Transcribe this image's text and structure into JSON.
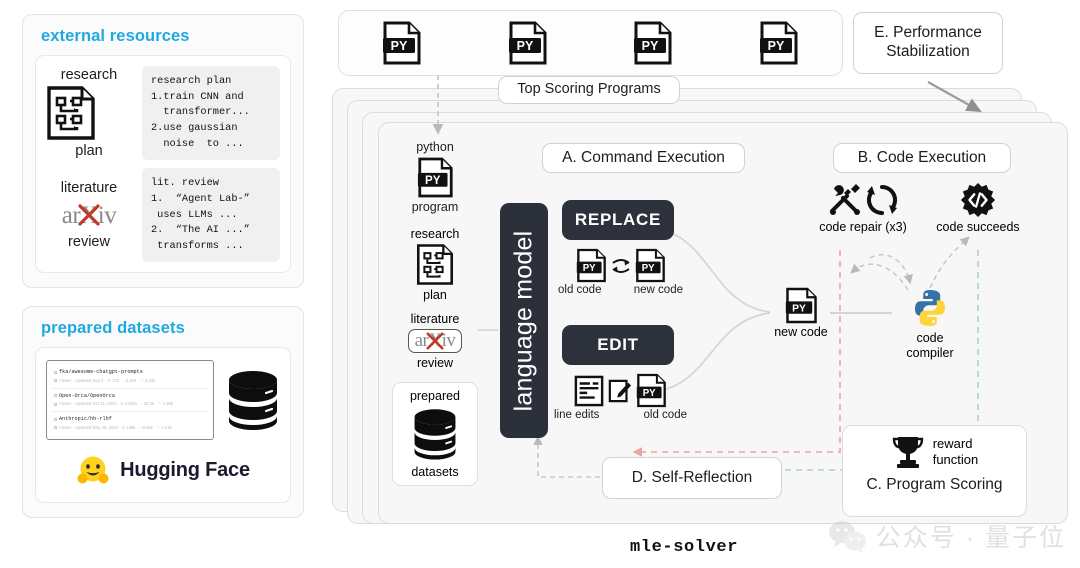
{
  "diagram": {
    "footer_label": "mle-solver",
    "watermark_text": "公众号 · 量子位",
    "accent_blue": "#22a8e0",
    "dark_block": "#2b303b",
    "arrow_red": "#e8a5a5",
    "arrow_green": "#a9d7b4",
    "arrow_gray": "#c9c9c9"
  },
  "external_resources": {
    "title": "external resources",
    "items": [
      {
        "label_top": "research",
        "label_bottom": "plan",
        "icon": "research-plan-document-icon",
        "code_text": "research plan\n1.train CNN and\n  transformer...\n2.use gaussian\n  noise  to ..."
      },
      {
        "label_top": "literature",
        "label_bottom": "review",
        "icon": "arxiv-logo-icon",
        "logo_text": "arXiv",
        "code_text": "lit. review\n1.  “Agent Lab-”\n uses LLMs ...\n2.  “The AI ...”\n transforms ..."
      }
    ]
  },
  "prepared_datasets": {
    "title": "prepared datasets",
    "rows": [
      {
        "name": "fka/awesome-chatgpt-prompts",
        "meta": "Viewer  ·  Updated Sep 3  ·  ⟳ 173  ·  ↓ 5,344  ·  ♡ 4,42k"
      },
      {
        "name": "Open-Orca/OpenOrca",
        "meta": "Viewer  ·  Updated Oct 21, 2023  ·  ⟳ 2.91M  ·  ↓ 33.4k  ·  ♡ 1.36k"
      },
      {
        "name": "Anthropic/hh-rlhf",
        "meta": "Viewer  ·  Updated May 26, 2023  ·  ⟳ 169k  ·  ↓ 8.55k  ·  ♡ 1.21k"
      }
    ],
    "database_icon": "database-stack-icon",
    "brand_text": "Hugging Face",
    "brand_icon": "hugging-face-emoji-icon"
  },
  "top_programs": {
    "label": "Top Scoring Programs",
    "program_icon": "python-file-icon",
    "program_count": 4
  },
  "input_column": {
    "items": [
      {
        "label_top": "python",
        "label_bottom": "program",
        "icon": "python-file-icon"
      },
      {
        "label_top": "research",
        "label_bottom": "plan",
        "icon": "research-plan-document-icon"
      },
      {
        "label_top": "literature",
        "label_bottom": "review",
        "icon": "arxiv-logo-icon",
        "logo_text": "arXiv"
      },
      {
        "label_top": "prepared",
        "label_bottom": "datasets",
        "icon": "database-stack-icon"
      }
    ]
  },
  "language_model": {
    "label": "language model"
  },
  "sections": {
    "a": {
      "title": "A. Command Execution"
    },
    "b": {
      "title": "B. Code Execution"
    },
    "c": {
      "title": "C. Program Scoring"
    },
    "d": {
      "title": "D. Self-Reflection"
    },
    "e": {
      "title": "E. Performance\nStabilization",
      "line1": "E. Performance",
      "line2": "Stabilization"
    }
  },
  "commands": {
    "replace": {
      "label": "REPLACE",
      "operands": [
        {
          "caption": "old code",
          "icon": "python-file-icon"
        },
        {
          "caption": "new code",
          "icon": "python-file-icon"
        }
      ],
      "relation_icon": "swap-arrows-icon"
    },
    "edit": {
      "label": "EDIT",
      "operands": [
        {
          "caption": "line edits",
          "icon": "line-edits-icon"
        },
        {
          "caption": "old code",
          "icon": "python-file-icon"
        }
      ],
      "relation_icon": "pencil-edit-icon"
    }
  },
  "code_execution": {
    "new_code": {
      "caption": "new code",
      "icon": "python-file-icon"
    },
    "compiler": {
      "caption": "code\ncompiler",
      "line1": "code",
      "line2": "compiler",
      "icon": "python-logo-icon"
    },
    "repair": {
      "caption": "code repair (x3)",
      "icon": "tools-refresh-icon"
    },
    "succeeds": {
      "caption": "code succeeds",
      "icon": "code-gear-icon"
    }
  },
  "program_scoring": {
    "reward": {
      "line1": "reward",
      "line2": "function",
      "icon": "trophy-icon"
    }
  }
}
